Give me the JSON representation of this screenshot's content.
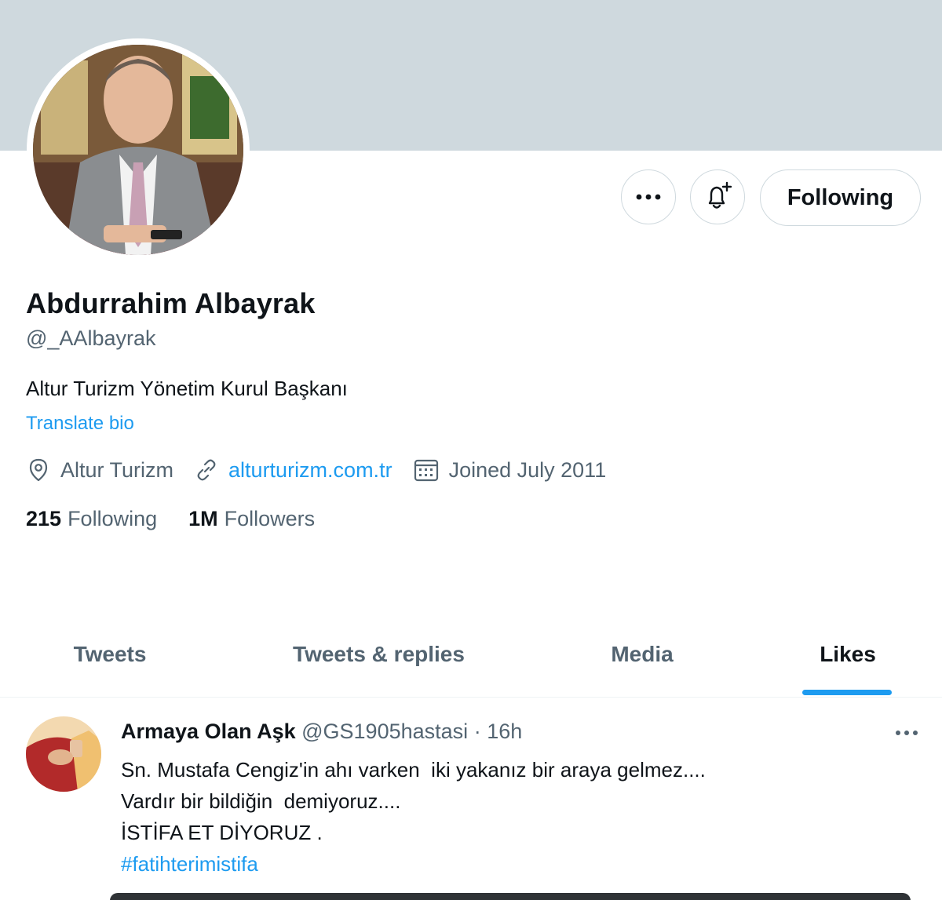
{
  "profile": {
    "name": "Abdurrahim Albayrak",
    "handle": "@_AAlbayrak",
    "bio": "Altur Turizm Yönetim Kurul Başkanı",
    "translate_label": "Translate bio",
    "location": "Altur Turizm",
    "website": "alturturizm.com.tr",
    "joined": "Joined July 2011",
    "following_count": "215",
    "following_label": "Following",
    "followers_count": "1M",
    "followers_label": "Followers"
  },
  "actions": {
    "follow_button_label": "Following",
    "more_icon": "more-horizontal-icon",
    "notify_icon": "bell-plus-icon"
  },
  "tabs": [
    {
      "label": "Tweets",
      "active": false
    },
    {
      "label": "Tweets & replies",
      "active": false
    },
    {
      "label": "Media",
      "active": false
    },
    {
      "label": "Likes",
      "active": true
    }
  ],
  "tweet": {
    "author_name": "Armaya Olan Aşk",
    "author_handle": "@GS1905hastasi",
    "separator": "·",
    "time": "16h",
    "lines": [
      "Sn. Mustafa Cengiz'in ahı varken  iki yakanız bir araya gelmez....",
      "Vardır bir bildiğin  demiyoruz....",
      "İSTİFA ET DİYORUZ ."
    ],
    "hashtag": "#fatihterimistifa"
  },
  "colors": {
    "banner": "#cfd9de",
    "accent": "#1d9bf0",
    "text_primary": "#0f1419",
    "text_secondary": "#536471"
  }
}
